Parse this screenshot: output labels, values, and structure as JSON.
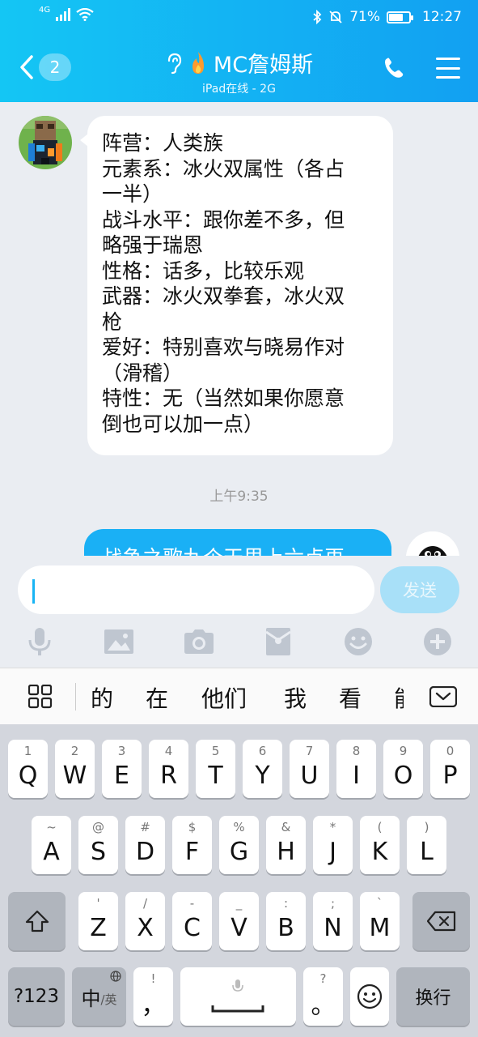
{
  "status_bar": {
    "network": "4G",
    "battery_text": "71%",
    "battery_level": 0.71,
    "time": "12:27"
  },
  "header": {
    "back_badge": "2",
    "title": "MC詹姆斯",
    "subtitle": "iPad在线 - 2G"
  },
  "chat": {
    "incoming_lines": [
      "阵营：人类族",
      "元素系：冰火双属性（各占",
      "一半）",
      "战斗水平：跟你差不多，但",
      "略强于瑞恩",
      "性格：话多，比较乐观",
      "武器：冰火双拳套，冰火双",
      "枪",
      "爱好：特别喜欢与晓易作对",
      "（滑稽）",
      "特性：无（当然如果你愿意",
      "倒也可以加一点）"
    ],
    "timestamp": "上午9:35",
    "outgoing_partial": "战争之歌九个天里上六点再"
  },
  "input": {
    "value": "",
    "send_label": "发送"
  },
  "toolbar": {
    "icons": [
      "microphone-icon",
      "image-icon",
      "camera-icon",
      "red-packet-icon",
      "emoji-icon",
      "plus-icon"
    ]
  },
  "candidates": {
    "words": [
      "的",
      "在",
      "他们",
      "我",
      "看",
      "能"
    ]
  },
  "keyboard": {
    "row1": [
      {
        "sub": "1",
        "main": "Q"
      },
      {
        "sub": "2",
        "main": "W"
      },
      {
        "sub": "3",
        "main": "E"
      },
      {
        "sub": "4",
        "main": "R"
      },
      {
        "sub": "5",
        "main": "T"
      },
      {
        "sub": "6",
        "main": "Y"
      },
      {
        "sub": "7",
        "main": "U"
      },
      {
        "sub": "8",
        "main": "I"
      },
      {
        "sub": "9",
        "main": "O"
      },
      {
        "sub": "0",
        "main": "P"
      }
    ],
    "row2": [
      {
        "sub": "~",
        "main": "A"
      },
      {
        "sub": "@",
        "main": "S"
      },
      {
        "sub": "#",
        "main": "D"
      },
      {
        "sub": "$",
        "main": "F"
      },
      {
        "sub": "%",
        "main": "G"
      },
      {
        "sub": "&",
        "main": "H"
      },
      {
        "sub": "*",
        "main": "J"
      },
      {
        "sub": "(",
        "main": "K"
      },
      {
        "sub": ")",
        "main": "L"
      }
    ],
    "row3": [
      {
        "sub": "'",
        "main": "Z"
      },
      {
        "sub": "/",
        "main": "X"
      },
      {
        "sub": "-",
        "main": "C"
      },
      {
        "sub": "_",
        "main": "V"
      },
      {
        "sub": ":",
        "main": "B"
      },
      {
        "sub": ";",
        "main": "N"
      },
      {
        "sub": "`",
        "main": "M"
      }
    ],
    "num_key": "?123",
    "lang_key_main": "中",
    "lang_key_sub": "/英",
    "comma_key": {
      "sub": "!",
      "main": "，"
    },
    "period_key": {
      "sub": "?",
      "main": "。"
    },
    "enter_key": "换行"
  }
}
